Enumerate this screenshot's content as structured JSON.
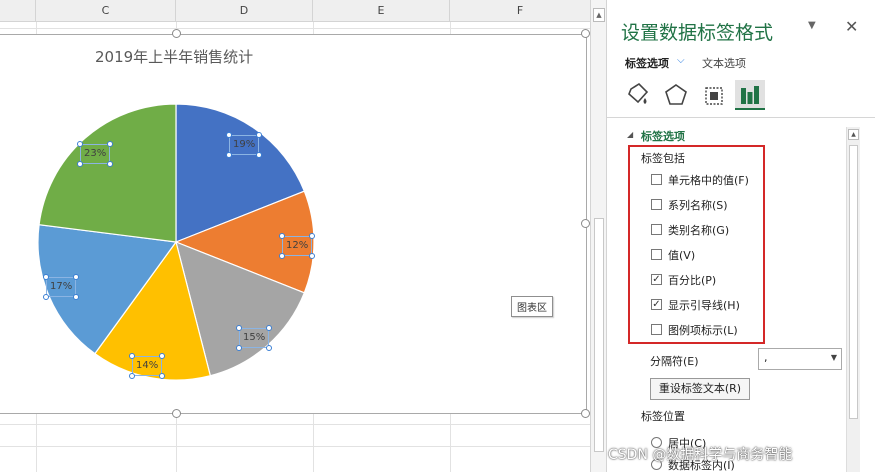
{
  "sheet": {
    "columns": [
      "C",
      "D",
      "E",
      "F"
    ]
  },
  "chart": {
    "title": "2019年上半年销售统计",
    "chart_area_tooltip": "图表区"
  },
  "chart_data": {
    "type": "pie",
    "title": "2019年上半年销售统计",
    "categories": [],
    "values": [
      19,
      12,
      15,
      14,
      17,
      23
    ],
    "labels": [
      "19%",
      "12%",
      "15%",
      "14%",
      "17%",
      "23%"
    ],
    "colors": [
      "#4472c4",
      "#ed7d31",
      "#a5a5a5",
      "#ffc000",
      "#5b9bd5",
      "#70ad47"
    ],
    "data_labels": "percentage",
    "legend": "none"
  },
  "pane": {
    "title": "设置数据标签格式",
    "tab_label_options": "标签选项",
    "tab_text_options": "文本选项",
    "section_title": "标签选项",
    "group_label": "标签包括",
    "options": [
      {
        "label": "单元格中的值(F)",
        "checked": false
      },
      {
        "label": "系列名称(S)",
        "checked": false
      },
      {
        "label": "类别名称(G)",
        "checked": false
      },
      {
        "label": "值(V)",
        "checked": false
      },
      {
        "label": "百分比(P)",
        "checked": true
      },
      {
        "label": "显示引导线(H)",
        "checked": true
      },
      {
        "label": "图例项标示(L)",
        "checked": false
      }
    ],
    "separator_label": "分隔符(E)",
    "separator_value": ",",
    "reset_button": "重设标签文本(R)",
    "position_label": "标签位置",
    "position_options": [
      "居中(C)",
      "数据标签内(I)"
    ],
    "icons": [
      "fill-line-icon",
      "effects-icon",
      "size-properties-icon",
      "label-options-icon"
    ],
    "accent": "#217346",
    "highlight": "#d42828"
  },
  "watermark": "CSDN @数据科学与商务智能"
}
